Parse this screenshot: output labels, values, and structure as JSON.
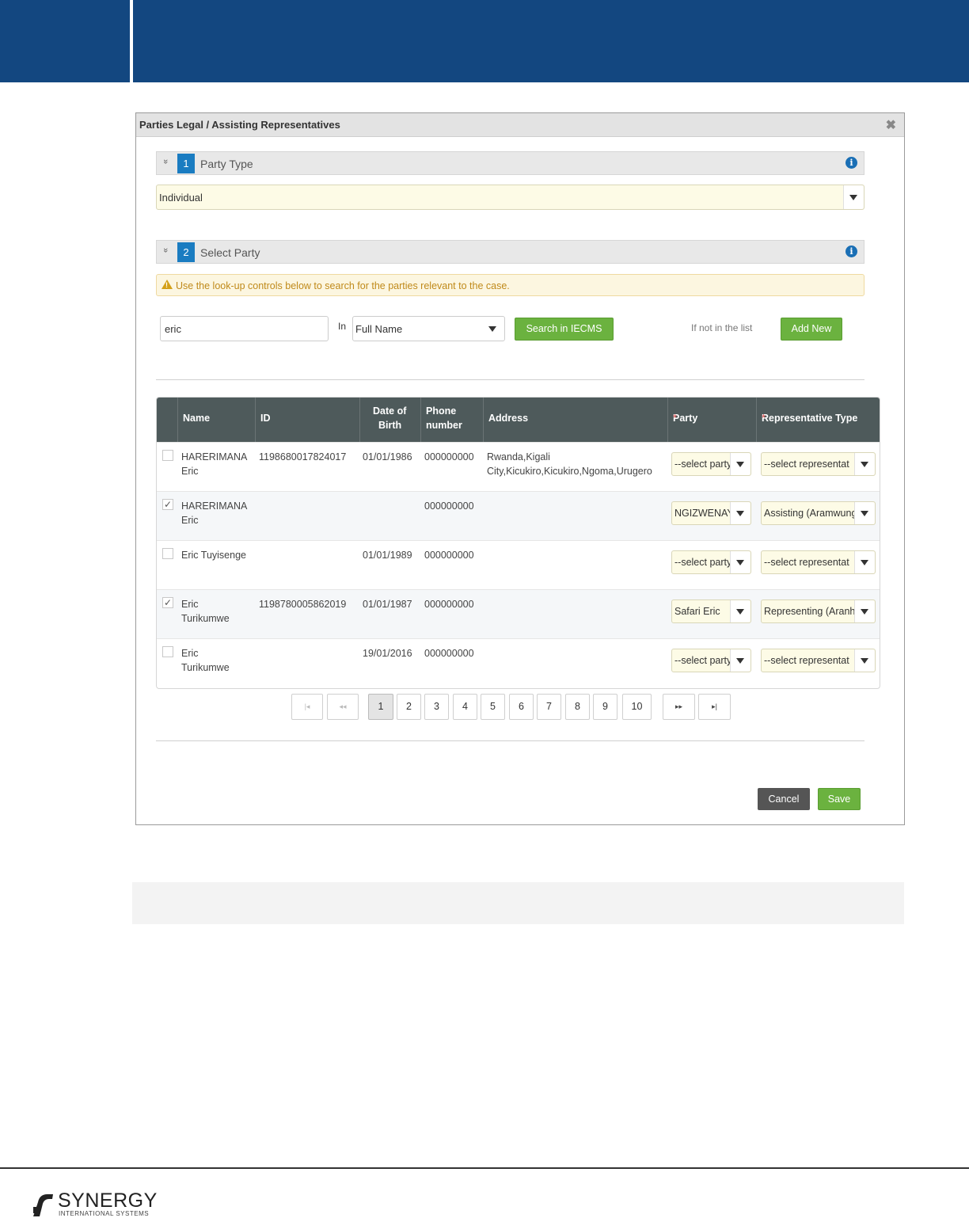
{
  "dialog": {
    "title": "Parties Legal / Assisting Representatives",
    "close_glyph": "✖"
  },
  "section1": {
    "chevron": "»",
    "number": "1",
    "label": "Party Type",
    "info": "i",
    "selected": "Individual"
  },
  "section2": {
    "chevron": "»",
    "number": "2",
    "label": "Select Party",
    "info": "i"
  },
  "warning": {
    "text": "Use the look-up controls below to search for the parties relevant to the case."
  },
  "search": {
    "value": "eric",
    "in_label": "In",
    "field": "Full Name",
    "search_button": "Search in IECMS",
    "not_in_list": "If not in the list",
    "add_new_button": "Add New"
  },
  "table": {
    "headers": {
      "name": "Name",
      "id": "ID",
      "dob": "Date of Birth",
      "dob_line1": "Date of",
      "dob_line2": "Birth",
      "phone_line1": "Phone",
      "phone_line2": "number",
      "address": "Address",
      "party": "Party",
      "rep_type": "Representative Type",
      "required_mark": "*"
    },
    "rows": [
      {
        "checked": false,
        "name1": "HARERIMANA",
        "name2": "Eric",
        "id": "1198680017824017",
        "dob": "01/01/1986",
        "phone": "000000000",
        "addr1": "Rwanda,Kigali",
        "addr2": "City,Kicukiro,Kicukiro,Ngoma,Urugero",
        "party": "--select party",
        "rep": "--select representat"
      },
      {
        "checked": true,
        "name1": "HARERIMANA",
        "name2": "Eric",
        "id": "",
        "dob": "",
        "phone": "000000000",
        "addr1": "",
        "addr2": "",
        "party": "NGIZWENAYO",
        "rep": "Assisting (Aramwunganira)"
      },
      {
        "checked": false,
        "name1": "Eric Tuyisenge",
        "name2": "",
        "id": "",
        "dob": "01/01/1989",
        "phone": "000000000",
        "addr1": "",
        "addr2": "",
        "party": "--select party",
        "rep": "--select representat"
      },
      {
        "checked": true,
        "name1": "Eric",
        "name2": "Turikumwe",
        "id": "1198780005862019",
        "dob": "01/01/1987",
        "phone": "000000000",
        "addr1": "",
        "addr2": "",
        "party": "Safari Eric",
        "rep": "Representing (Aranhagarariye)"
      },
      {
        "checked": false,
        "name1": "Eric",
        "name2": "Turikumwe",
        "id": "",
        "dob": "19/01/2016",
        "phone": "000000000",
        "addr1": "",
        "addr2": "",
        "party": "--select party",
        "rep": "--select representat"
      }
    ],
    "check_glyph": "✓"
  },
  "pagination": {
    "first": "|◂",
    "prev": "◂◂",
    "pages": [
      "1",
      "2",
      "3",
      "4",
      "5",
      "6",
      "7",
      "8",
      "9",
      "10"
    ],
    "active_page": "1",
    "next": "▸▸",
    "last": "▸|"
  },
  "actions": {
    "cancel": "Cancel",
    "save": "Save"
  },
  "brand": {
    "name": "SYNERGY",
    "tagline": "INTERNATIONAL SYSTEMS"
  },
  "colors": {
    "header_blue": "#134780",
    "accent_blue": "#1a7cc1",
    "green": "#6bb23f",
    "grid_header": "#4e5a5b",
    "select_yellow": "#fdfbe6"
  },
  "icons": [
    "chevron-double-down-icon",
    "info-icon",
    "warning-icon",
    "caret-down-icon",
    "close-icon",
    "checkbox-icon"
  ]
}
